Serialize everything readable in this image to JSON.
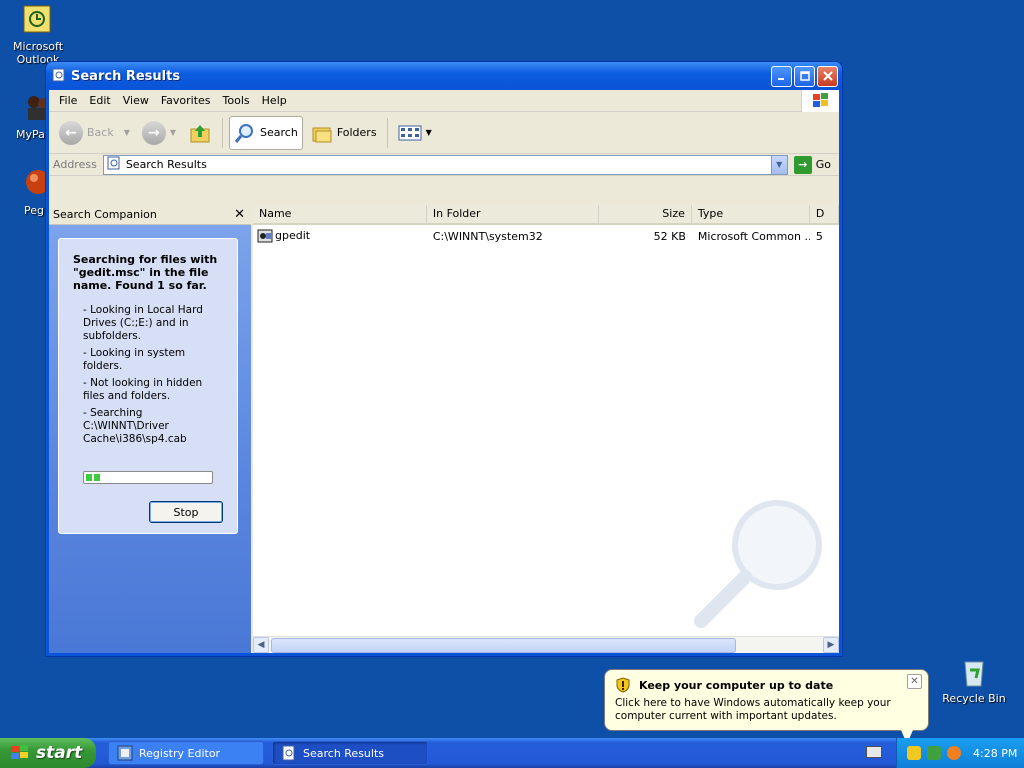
{
  "desktop": {
    "icons": [
      {
        "label": "Microsoft Outlook"
      },
      {
        "label": "MyPa"
      },
      {
        "label": "Peg"
      },
      {
        "label": "Recycle Bin"
      }
    ]
  },
  "window": {
    "title": "Search Results",
    "menu": [
      "File",
      "Edit",
      "View",
      "Favorites",
      "Tools",
      "Help"
    ],
    "toolbar": {
      "back_label": "Back",
      "search_label": "Search",
      "folders_label": "Folders"
    },
    "address": {
      "label": "Address",
      "value": "Search Results",
      "go_label": "Go"
    }
  },
  "companion": {
    "title": "Search Companion",
    "close_glyph": "✕",
    "status_heading": "Searching for files with \"gedit.msc\" in the file name.  Found 1 so far.",
    "status_items": [
      "- Looking in Local Hard Drives (C:;E:) and in subfolders.",
      "- Looking in system folders.",
      "- Not looking in hidden files and folders.",
      "- Searching C:\\WINNT\\Driver Cache\\i386\\sp4.cab"
    ],
    "progress_chunks": 2,
    "stop_label": "Stop"
  },
  "results": {
    "columns": [
      "Name",
      "In Folder",
      "Size",
      "Type",
      "D"
    ],
    "rows": [
      {
        "name": "gpedit",
        "folder": "C:\\WINNT\\system32",
        "size": "52 KB",
        "type": "Microsoft Common ...",
        "d": "5"
      }
    ]
  },
  "balloon": {
    "title": "Keep your computer up to date",
    "body": "Click here to have Windows automatically keep your computer current with important updates."
  },
  "taskbar": {
    "start_label": "start",
    "tasks": [
      {
        "label": "Registry Editor"
      },
      {
        "label": "Search Results"
      }
    ],
    "clock": "4:28 PM"
  }
}
